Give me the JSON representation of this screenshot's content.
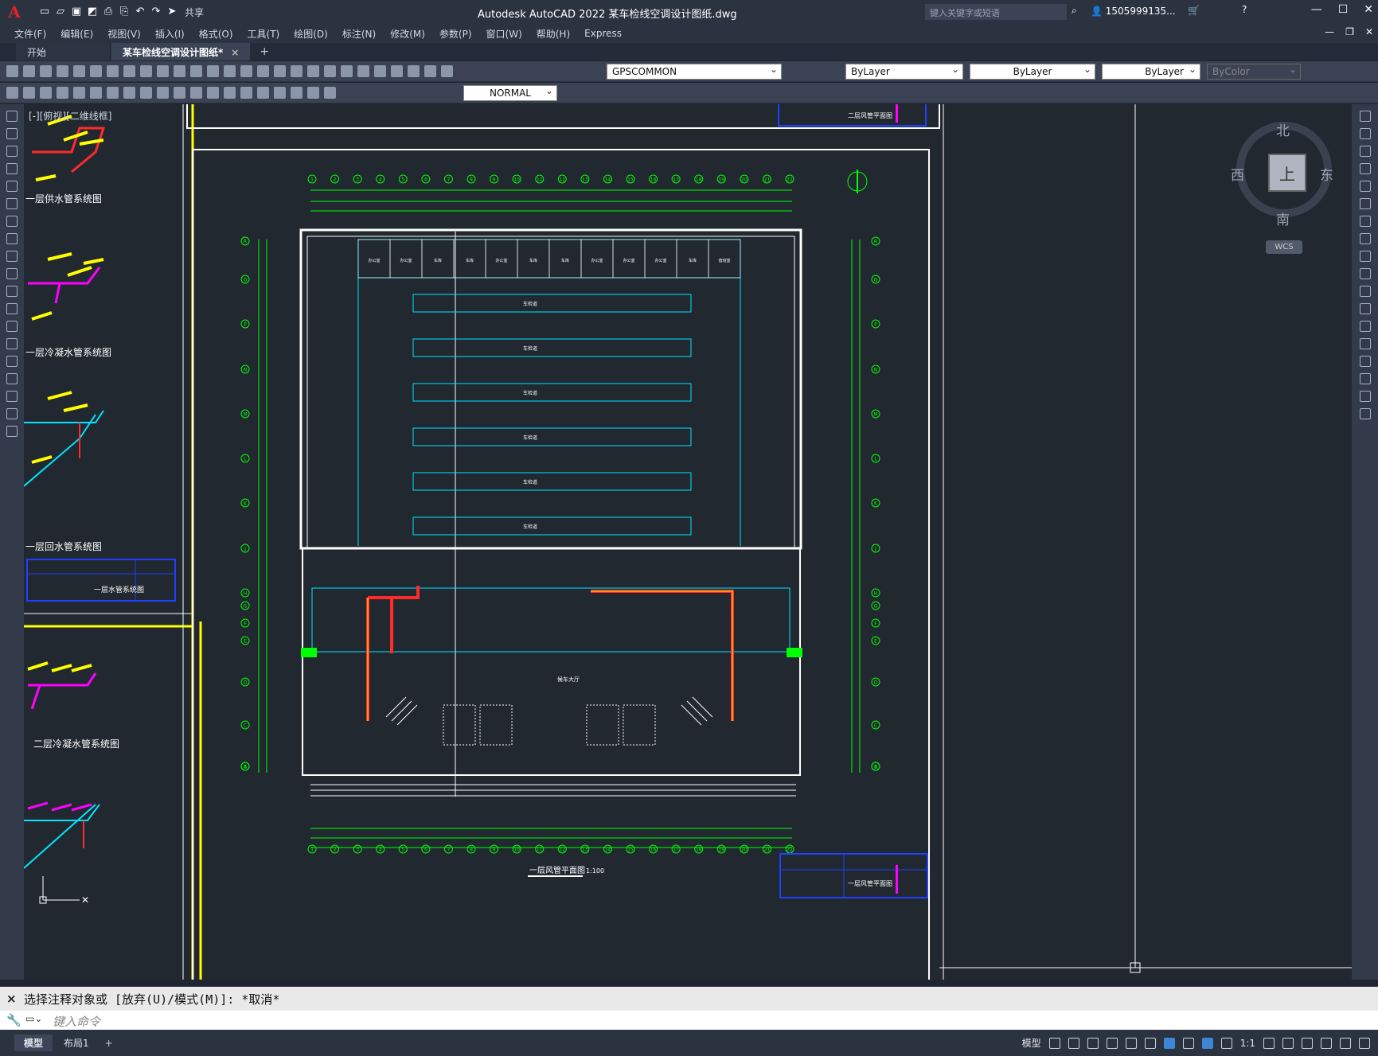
{
  "app": {
    "title": "Autodesk AutoCAD 2022    某车检线空调设计图纸.dwg",
    "share_label": "共享",
    "search_placeholder": "键入关键字或短语",
    "user": "1505999135..."
  },
  "menu": {
    "items": [
      "文件(F)",
      "编辑(E)",
      "视图(V)",
      "插入(I)",
      "格式(O)",
      "工具(T)",
      "绘图(D)",
      "标注(N)",
      "修改(M)",
      "参数(P)",
      "窗口(W)",
      "帮助(H)",
      "Express"
    ]
  },
  "tabs": {
    "start": "开始",
    "doc": "某车检线空调设计图纸*",
    "close": "×",
    "plus": "+"
  },
  "toolbar1": {
    "layer": "GPSCOMMON",
    "color": "ByLayer",
    "linetype": "ByLayer",
    "lineweight": "ByLayer",
    "plotstyle": "ByColor"
  },
  "toolbar2": {
    "style": "NORMAL"
  },
  "viewport": {
    "label": "[-][俯视][二维线框]"
  },
  "navcube": {
    "north": "北",
    "south": "南",
    "east": "东",
    "west": "西",
    "top": "上",
    "wcs": "WCS"
  },
  "drawing": {
    "left_titles": [
      "一层供水管系统图",
      "一层冷凝水管系统图",
      "一层回水管系统图",
      "二层冷凝水管系统图"
    ],
    "titleblock_left": "一层水管系统图",
    "titleblock_top": "二层风管平面图",
    "titleblock_bottom": "一层风管平面图",
    "main_title": "一层风管平面图",
    "main_scale": "1:100",
    "axis_numbers": [
      "1",
      "2",
      "3",
      "4",
      "5",
      "6",
      "7",
      "8",
      "9",
      "10",
      "11",
      "12",
      "13",
      "14",
      "15",
      "16",
      "17",
      "18",
      "19",
      "20",
      "21",
      "22"
    ],
    "axis_letters": [
      "R",
      "Q",
      "P",
      "N",
      "M",
      "L",
      "K",
      "J",
      "H",
      "G",
      "F",
      "E",
      "D",
      "C",
      "B",
      "A"
    ],
    "bay_labels": [
      "车检道",
      "车检道",
      "车检道",
      "车检道",
      "车检道",
      "车检道"
    ],
    "hall_label": "候车大厅",
    "rooms": [
      "办公室",
      "办公室",
      "车库",
      "车库",
      "办公室",
      "车库",
      "车库",
      "办公室",
      "办公室",
      "办公室",
      "车库",
      "值班室"
    ]
  },
  "command": {
    "history": "选择注释对象或 [放弃(U)/模式(M)]: *取消*",
    "prompt": "键入命令",
    "close": "×"
  },
  "status": {
    "model_tab": "模型",
    "layout_tab": "布局1",
    "plus": "+",
    "model": "模型",
    "scale": "1:1"
  },
  "colors": {
    "green": "#00ff00",
    "cyan": "#00e5ff",
    "red": "#ff2a2a",
    "yellow": "#ffff00",
    "magenta": "#ff00ff",
    "blue": "#2040ff",
    "white": "#ffffff",
    "canvas": "#212830"
  },
  "icons": [
    "autocad-logo-icon",
    "new-icon",
    "open-icon",
    "save-icon",
    "saveas-icon",
    "print-icon",
    "undo-icon",
    "redo-icon",
    "share-icon",
    "search-icon",
    "user-icon",
    "cart-icon",
    "help-icon",
    "minimize-icon",
    "maximize-icon",
    "close-icon"
  ]
}
